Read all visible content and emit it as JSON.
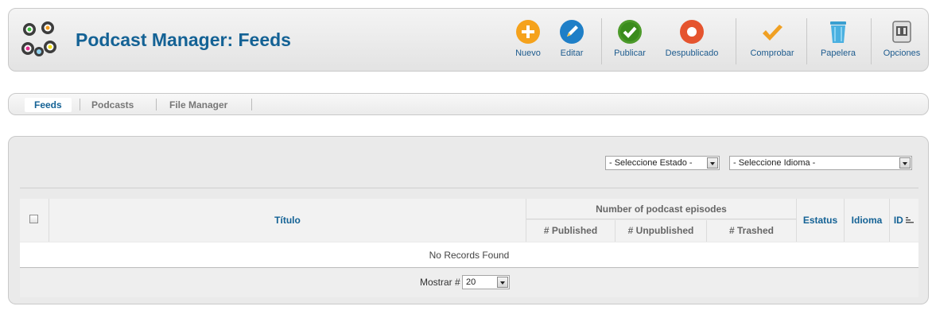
{
  "header": {
    "title": "Podcast Manager: Feeds"
  },
  "toolbar": {
    "buttons": [
      {
        "label": "Nuevo",
        "icon": "add-icon",
        "color": "#f5a21c"
      },
      {
        "label": "Editar",
        "icon": "edit-icon",
        "color": "#1f7fc7"
      },
      {
        "label": "Publicar",
        "icon": "publish-icon",
        "color": "#4c9a2a"
      },
      {
        "label": "Despublicado",
        "icon": "unpublish-icon",
        "color": "#e5542e"
      },
      {
        "label": "Comprobar",
        "icon": "check-icon",
        "color": "#f0a023"
      },
      {
        "label": "Papelera",
        "icon": "trash-icon",
        "color": "#4ab0e0"
      },
      {
        "label": "Opciones",
        "icon": "options-icon",
        "color": "#888888"
      }
    ]
  },
  "submenu": {
    "items": [
      {
        "label": "Feeds",
        "active": true
      },
      {
        "label": "Podcasts",
        "active": false
      },
      {
        "label": "File Manager",
        "active": false
      }
    ]
  },
  "filters": {
    "estado": "- Seleccione Estado -",
    "idioma": "- Seleccione Idioma -"
  },
  "table": {
    "col_titulo": "Título",
    "col_group": "Number of podcast episodes",
    "col_published": "# Published",
    "col_unpublished": "# Unpublished",
    "col_trashed": "# Trashed",
    "col_estatus": "Estatus",
    "col_idioma": "Idioma",
    "col_id": "ID",
    "empty_message": "No Records Found"
  },
  "pagination": {
    "label": "Mostrar #",
    "value": "20"
  }
}
